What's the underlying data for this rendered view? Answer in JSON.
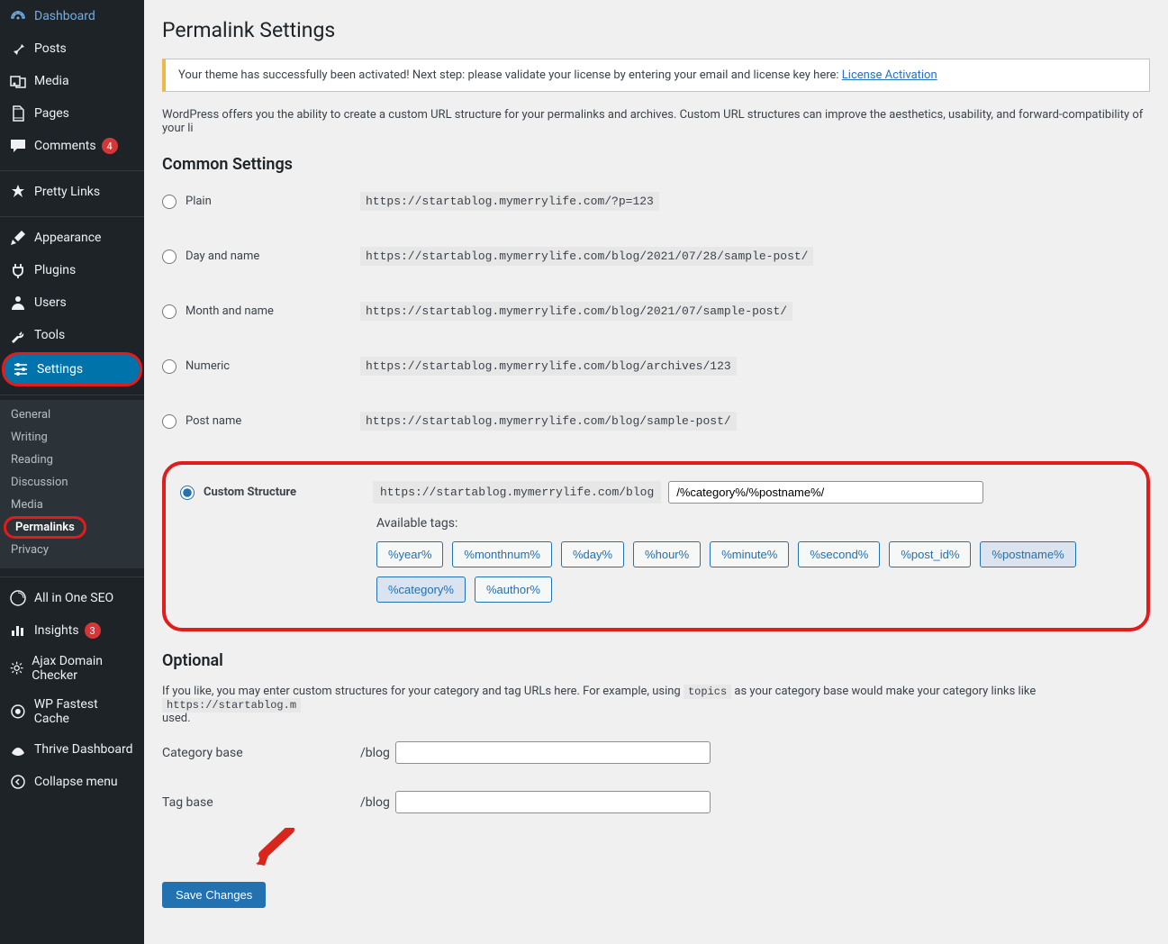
{
  "sidebar": {
    "items": [
      {
        "label": "Dashboard",
        "icon": "dashboard"
      },
      {
        "label": "Posts",
        "icon": "pin"
      },
      {
        "label": "Media",
        "icon": "media"
      },
      {
        "label": "Pages",
        "icon": "pages"
      },
      {
        "label": "Comments",
        "icon": "comment",
        "badge": "4"
      },
      {
        "label": "Pretty Links",
        "icon": "star"
      },
      {
        "label": "Appearance",
        "icon": "brush"
      },
      {
        "label": "Plugins",
        "icon": "plug"
      },
      {
        "label": "Users",
        "icon": "user"
      },
      {
        "label": "Tools",
        "icon": "wrench"
      },
      {
        "label": "Settings",
        "icon": "sliders",
        "current": true,
        "highlight": true
      },
      {
        "label": "All in One SEO",
        "icon": "seo"
      },
      {
        "label": "Insights",
        "icon": "insights",
        "badge": "3"
      },
      {
        "label": "Ajax Domain Checker",
        "icon": "gear"
      },
      {
        "label": "WP Fastest Cache",
        "icon": "cache"
      },
      {
        "label": "Thrive Dashboard",
        "icon": "thrive"
      },
      {
        "label": "Collapse menu",
        "icon": "collapse"
      }
    ],
    "subitems": [
      {
        "label": "General"
      },
      {
        "label": "Writing"
      },
      {
        "label": "Reading"
      },
      {
        "label": "Discussion"
      },
      {
        "label": "Media"
      },
      {
        "label": "Permalinks",
        "active": true,
        "highlight": true
      },
      {
        "label": "Privacy"
      }
    ]
  },
  "page": {
    "title": "Permalink Settings",
    "notice_text": "Your theme has successfully been activated! Next step: please validate your license by entering your email and license key here: ",
    "notice_link": "License Activation",
    "intro": "WordPress offers you the ability to create a custom URL structure for your permalinks and archives. Custom URL structures can improve the aesthetics, usability, and forward-compatibility of your li",
    "common_heading": "Common Settings",
    "structures": [
      {
        "label": "Plain",
        "example": "https://startablog.mymerrylife.com/?p=123"
      },
      {
        "label": "Day and name",
        "example": "https://startablog.mymerrylife.com/blog/2021/07/28/sample-post/"
      },
      {
        "label": "Month and name",
        "example": "https://startablog.mymerrylife.com/blog/2021/07/sample-post/"
      },
      {
        "label": "Numeric",
        "example": "https://startablog.mymerrylife.com/blog/archives/123"
      },
      {
        "label": "Post name",
        "example": "https://startablog.mymerrylife.com/blog/sample-post/"
      }
    ],
    "custom": {
      "label": "Custom Structure",
      "prefix": "https://startablog.mymerrylife.com/blog",
      "value": "/%category%/%postname%/",
      "available_label": "Available tags:",
      "tags": [
        {
          "t": "%year%"
        },
        {
          "t": "%monthnum%"
        },
        {
          "t": "%day%"
        },
        {
          "t": "%hour%"
        },
        {
          "t": "%minute%"
        },
        {
          "t": "%second%"
        },
        {
          "t": "%post_id%"
        },
        {
          "t": "%postname%",
          "active": true
        },
        {
          "t": "%category%",
          "active": true
        },
        {
          "t": "%author%"
        }
      ]
    },
    "optional_heading": "Optional",
    "optional_text_1": "If you like, you may enter custom structures for your category and tag URLs here. For example, using ",
    "optional_code": "topics",
    "optional_text_2": " as your category base would make your category links like ",
    "optional_code2": "https://startablog.m",
    "optional_text_3": "used.",
    "category_base_label": "Category base",
    "tag_base_label": "Tag base",
    "base_prefix": "/blog",
    "save_label": "Save Changes"
  }
}
